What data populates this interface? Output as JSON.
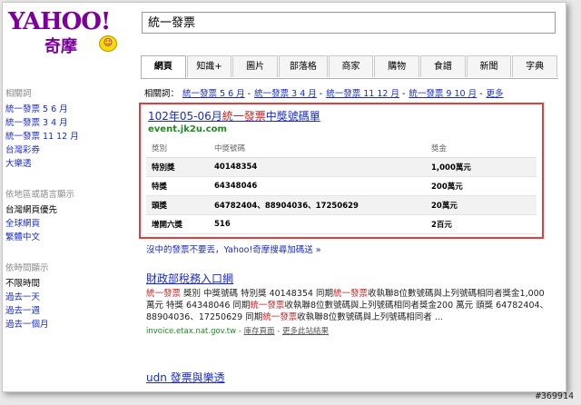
{
  "logo": {
    "brand": "YAHOO!",
    "sub": "奇摩",
    "smile": "☺"
  },
  "search": {
    "value": "統一發票"
  },
  "tabs": [
    "網頁",
    "知識+",
    "圖片",
    "部落格",
    "商家",
    "購物",
    "食譜",
    "新聞",
    "字典"
  ],
  "sidebar": {
    "related_head": "相關詞",
    "related": [
      "統一發票 5 6 月",
      "統一發票 3 4 月",
      "統一發票 11 12 月",
      "台灣彩券",
      "大樂透"
    ],
    "region_head": "依地區或語言顯示",
    "region": [
      "台灣網頁優先",
      "全球網頁",
      "繁體中文"
    ],
    "time_head": "依時間顯示",
    "time": [
      "不限時間",
      "過去一天",
      "過去一週",
      "過去一個月"
    ]
  },
  "related_bar": {
    "label": "相關詞：",
    "links": [
      "統一發票 5 6 月",
      "統一發票 3 4 月",
      "統一發票 11 12 月",
      "統一發票 9 10 月"
    ],
    "more": "更多"
  },
  "featured": {
    "title_pre": "102年05-06月",
    "title_red": "統一發票",
    "title_post": "中獎號碼單",
    "url": "event.jk2u.com",
    "headers": [
      "獎別",
      "中獎號碼",
      "獎金"
    ],
    "rows": [
      [
        "特別獎",
        "40148354",
        "1,000萬元"
      ],
      [
        "特獎",
        "64348046",
        "200萬元"
      ],
      [
        "頭獎",
        "64782404、88904036、17250629",
        "20萬元"
      ],
      [
        "增開六獎",
        "516",
        "2百元"
      ]
    ]
  },
  "more_line": "沒中的發票不要丟，Yahoo!奇摩搜尋加碼送 »",
  "result2": {
    "title": "財政部稅務入口網",
    "snip1_red": "統一發票",
    "snip1": " 獎別 中獎號碼 特別獎 40148354 同期",
    "snip1b_red": "統一發票",
    "snip1b": "收執聯8位數號碼與上列號碼相同者獎金1,000 萬元 特獎 64348046 同期",
    "snip2_red": "統一發票",
    "snip2": "收執聯8位數號碼與上列號碼相同者獎金200 萬元 頭獎 64782404、88904036、17250629 同期",
    "snip3_red": "統一發票",
    "snip3": "收執聯8位數號碼與上列號碼相同者 ...",
    "url": "invoice.etax.nat.gov.tw",
    "cache": "庫存頁面",
    "more_site": "更多此站結果"
  },
  "result3": {
    "title": "udn 發票與樂透"
  },
  "watermark": "#369914"
}
